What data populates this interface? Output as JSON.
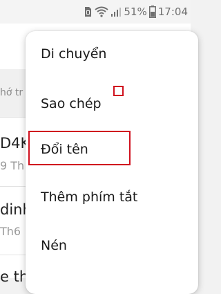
{
  "status_bar": {
    "battery_percent": "51%",
    "time": "17:04",
    "icons": [
      "sim-card-icon",
      "wifi-icon",
      "signal-icon",
      "battery-icon"
    ]
  },
  "background": {
    "header_partial": "hớ tr",
    "items": [
      {
        "title_partial": "D4K",
        "sub_partial": "9 Th"
      },
      {
        "title_partial": "dinh",
        "sub_partial": "Th6"
      },
      {
        "title_partial": "e th"
      }
    ]
  },
  "menu": {
    "items": [
      {
        "label": "Di chuyển"
      },
      {
        "label": "Sao chép"
      },
      {
        "label": "Đổi tên"
      },
      {
        "label": "Thêm phím tắt"
      },
      {
        "label": "Nén"
      }
    ]
  },
  "colors": {
    "highlight": "#d0101e",
    "menu_bg": "#ffffff",
    "text": "#1a1a1a"
  }
}
